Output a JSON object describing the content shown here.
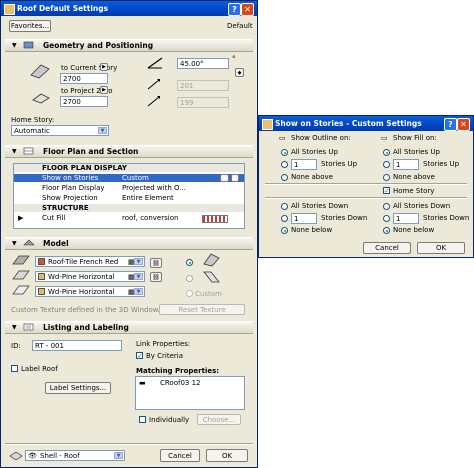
{
  "roof": {
    "title": "Roof Default Settings",
    "default_label": "Default",
    "favorites_label": "Favorites...",
    "geometry": {
      "header": "Geometry and Positioning",
      "to_current_story": "to Current Story",
      "value_top": "2700",
      "to_project_zero": "to Project Zero",
      "value_bottom": "2700",
      "angle": "45.00°",
      "pitch1": "201",
      "pitch2": "199",
      "home_story_label": "Home Story:",
      "home_story_value": "Automatic"
    },
    "floorplan": {
      "header": "Floor Plan and Section",
      "rows": [
        {
          "c1": "FLOOR PLAN DISPLAY",
          "c2": "",
          "type": "hdr"
        },
        {
          "c1": "Show on Stories",
          "c2": "Custom",
          "type": "sel"
        },
        {
          "c1": "Floor Plan Display",
          "c2": "Projected with O...",
          "type": ""
        },
        {
          "c1": "Show Projection",
          "c2": "Entire Element",
          "type": ""
        },
        {
          "c1": "STRUCTURE",
          "c2": "",
          "type": "hdr"
        },
        {
          "c1": "Cut Fill",
          "c2": "roof, conversion",
          "type": ""
        }
      ]
    },
    "model": {
      "header": "Model",
      "surface1": "Roof-Tile French Red",
      "surface2": "Wd-Pine Horizontal",
      "surface3": "Wd-Pine Horizontal",
      "custom_label": "Custom",
      "texture_note": "Custom Texture defined in the 3D Window.",
      "reset_texture": "Reset Texture"
    },
    "listing": {
      "header": "Listing and Labeling",
      "id_label": "ID:",
      "id_value": "RT - 001",
      "link_properties": "Link Properties:",
      "by_criteria": "By Criteria",
      "matching_properties": "Matching Properties:",
      "matching_item": "CRoof03 12",
      "label_roof": "Label Roof",
      "label_settings": "Label Settings...",
      "individually": "Individually",
      "choose": "Choose..."
    },
    "footer": {
      "layer": "Shell - Roof",
      "cancel": "Cancel",
      "ok": "OK"
    }
  },
  "stories": {
    "title": "Show on Stories - Custom Settings",
    "outline_header": "Show Outline on:",
    "fill_header": "Show Fill on:",
    "all_up": "All Stories Up",
    "n_up": "Stories Up",
    "none_above": "None above",
    "home_story": "Home Story",
    "all_down": "All Stories Down",
    "n_down": "Stories Down",
    "none_below": "None below",
    "count": "1",
    "cancel": "Cancel",
    "ok": "OK"
  },
  "colors": {
    "titlebar": "#0046c6",
    "dialog_bg": "#ece9d8",
    "selection": "#316ac5"
  }
}
